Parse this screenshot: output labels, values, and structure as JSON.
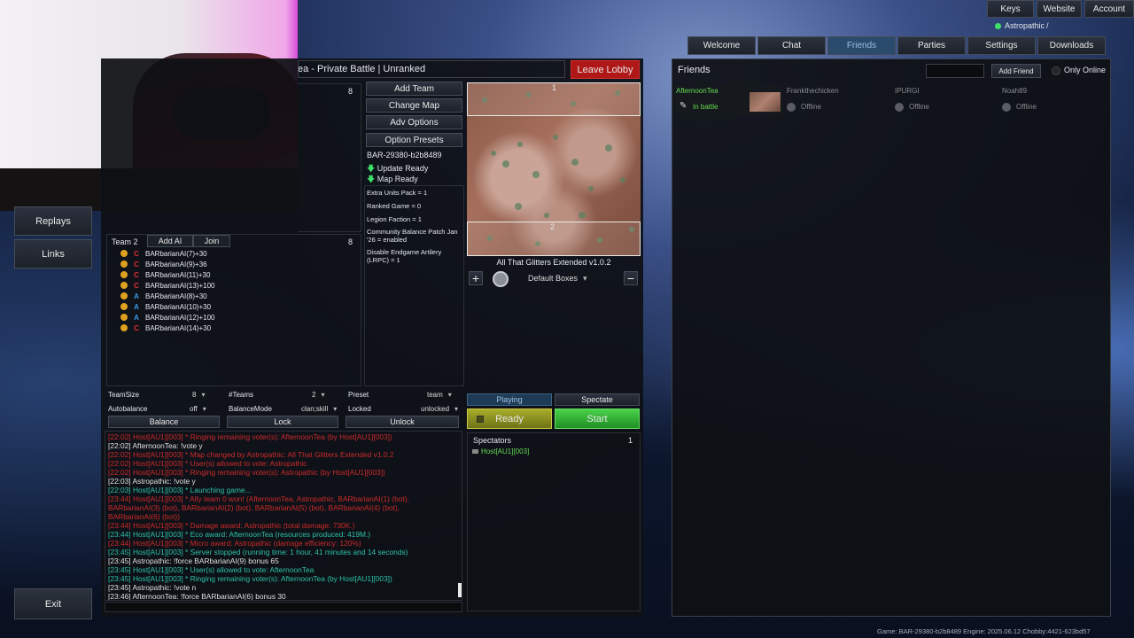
{
  "topbar": {
    "keys": "Keys",
    "website": "Website",
    "account": "Account",
    "user": "Astropathic"
  },
  "tabs": [
    "Welcome",
    "Chat",
    "Friends",
    "Parties",
    "Settings",
    "Downloads"
  ],
  "friends": {
    "title": "Friends",
    "add_label": "Add Friend",
    "only_online": "Only Online",
    "list": [
      {
        "name": "AfternoonTea",
        "status": "In battle"
      },
      {
        "name": "Frankthechicken",
        "status": "Offline"
      },
      {
        "name": "IPURGI",
        "status": "Offline"
      },
      {
        "name": "Noah89",
        "status": "Offline"
      }
    ]
  },
  "left_nav": {
    "replays": "Replays",
    "links": "Links",
    "exit": "Exit"
  },
  "battle": {
    "title": "ea - Private Battle | Unranked",
    "leave": "Leave Lobby",
    "team1_count": "8",
    "team2": {
      "label": "Team 2",
      "add_ai": "Add AI",
      "join": "Join",
      "count": "8",
      "players": [
        {
          "name": "BARbarianAI(7)+30",
          "faction": "C"
        },
        {
          "name": "BARbarianAI(9)+36",
          "faction": "C"
        },
        {
          "name": "BARbarianAI(11)+30",
          "faction": "C"
        },
        {
          "name": "BARbarianAI(13)+100",
          "faction": "C"
        },
        {
          "name": "BARbarianAI(8)+30",
          "faction": "A"
        },
        {
          "name": "BARbarianAI(10)+30",
          "faction": "A"
        },
        {
          "name": "BARbarianAI(12)+100",
          "faction": "A"
        },
        {
          "name": "BARbarianAI(14)+30",
          "faction": "C"
        }
      ]
    }
  },
  "mid": {
    "add_team": "Add Team",
    "change_map": "Change Map",
    "adv_options": "Adv Options",
    "option_presets": "Option Presets",
    "version": "BAR-29380-b2b8489",
    "update_ready": "Update Ready",
    "map_ready": "Map Ready",
    "options": [
      "Extra Units Pack = 1",
      "Ranked Game = 0",
      "Legion Faction = 1",
      "Community Balance Patch Jan '26 = enabled",
      "Disable Endgame Artilery (LRPC) = 1"
    ]
  },
  "map": {
    "name": "All That Glitters Extended v1.0.2",
    "box1": "1",
    "box2": "2",
    "boxes": "Default Boxes"
  },
  "settings": {
    "teamsize_label": "TeamSize",
    "teamsize": "8",
    "teams_label": "#Teams",
    "teams": "2",
    "preset_label": "Preset",
    "preset": "team",
    "autobalance_label": "Autobalance",
    "autobalance": "off",
    "balancemode_label": "BalanceMode",
    "balancemode": "clan;skill",
    "locked_label": "Locked",
    "locked": "unlocked",
    "balance": "Balance",
    "lock": "Lock",
    "unlock": "Unlock"
  },
  "status": {
    "playing": "Playing",
    "spectate": "Spectate",
    "ready": "Ready",
    "start": "Start"
  },
  "spectators": {
    "title": "Spectators",
    "count": "1",
    "list": [
      "Host[AU1][003]"
    ]
  },
  "chat": [
    {
      "text": "[22:02] Host[AU1][003] * Ringing remaining voter(s): AfternoonTea (by Host[AU1][003])",
      "color": "#cc2a2a"
    },
    {
      "text": "[22:02] AfternoonTea: !vote y",
      "color": "#e0e0e0"
    },
    {
      "text": "[22:02] Host[AU1][003] * Map changed by Astropathic: All That Glitters Extended v1.0.2",
      "color": "#cc2a2a"
    },
    {
      "text": "[22:02] Host[AU1][003] * User(s) allowed to vote: Astropathic",
      "color": "#cc2a2a"
    },
    {
      "text": "[22:02] Host[AU1][003] * Ringing remaining voter(s): Astropathic (by Host[AU1][003])",
      "color": "#cc2a2a"
    },
    {
      "text": "[22:03] Astropathic: !vote y",
      "color": "#e0e0e0"
    },
    {
      "text": "[22:03] Host[AU1][003] * Launching game...",
      "color": "#2ec2a8"
    },
    {
      "text": "[23:44] Host[AU1][003] * Ally team 0 won! (AfternoonTea, Astropathic, BARbarianAI(1) (bot),",
      "color": "#cc2a2a"
    },
    {
      "text": "BARbarianAI(3) (bot), BARbarianAI(2) (bot), BARbarianAI(5) (bot), BARbarianAI(4) (bot),",
      "color": "#cc2a2a"
    },
    {
      "text": "BARbarianAI(6) (bot))",
      "color": "#cc2a2a"
    },
    {
      "text": "[23:44] Host[AU1][003] *   Damage award:  Astropathic  (total damage: 730K.)",
      "color": "#cc2a2a"
    },
    {
      "text": "[23:44] Host[AU1][003] *   Eco award:     AfternoonTea  (resources produced: 419M.)",
      "color": "#2ec2a8"
    },
    {
      "text": "[23:44] Host[AU1][003] *   Micro award:   Astropathic  (damage efficiency: 120%)",
      "color": "#cc2a2a"
    },
    {
      "text": "[23:45] Host[AU1][003] * Server stopped (running time: 1 hour, 41 minutes and 14 seconds)",
      "color": "#2ec2a8"
    },
    {
      "text": "[23:45] Astropathic: !force BARbarianAI(9) bonus 65",
      "color": "#e0e0e0"
    },
    {
      "text": "[23:45] Host[AU1][003] * User(s) allowed to vote: AfternoonTea",
      "color": "#2ec2a8"
    },
    {
      "text": "[23:45] Host[AU1][003] * Ringing remaining voter(s): AfternoonTea (by Host[AU1][003])",
      "color": "#2ec2a8"
    },
    {
      "text": "[23:45] Astropathic: !vote n",
      "color": "#e0e0e0"
    },
    {
      "text": "[23:46] AfternoonTea: !force BARbarianAI(6) bonus 30",
      "color": "#e0e0e0"
    }
  ],
  "footer": "Game: BAR-29380-b2b8489  Engine: 2025.06.12  Chobby:4421-623bd57"
}
